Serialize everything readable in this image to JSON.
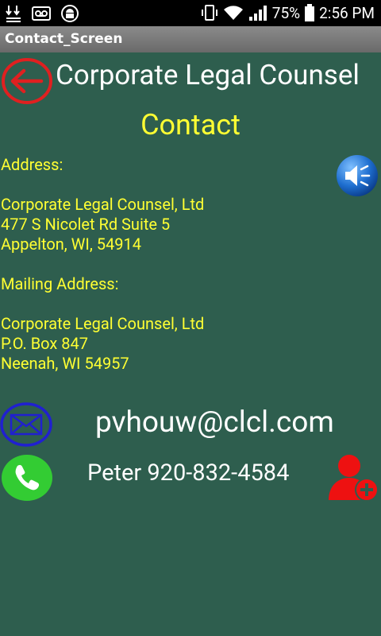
{
  "status_bar": {
    "battery_percent": "75%",
    "time": "2:56 PM",
    "left_icons": [
      "download-arrows-icon",
      "voicemail-icon",
      "android-robot-icon"
    ],
    "right_icons": [
      "vibrate-icon",
      "wifi-icon",
      "cellular-signal-icon",
      "battery-icon"
    ]
  },
  "app_bar": {
    "title": "Contact_Screen"
  },
  "header": {
    "company_name": "Corporate Legal Counsel",
    "back_icon": "back-arrow-icon"
  },
  "section": {
    "heading": "Contact"
  },
  "address": {
    "label": "Address:",
    "line1": "Corporate Legal Counsel, Ltd",
    "line2": "477 S Nicolet Rd Suite 5",
    "line3": "Appelton, WI, 54914"
  },
  "mailing": {
    "label": "Mailing Address:",
    "line1": "Corporate Legal Counsel, Ltd",
    "line2": "P.O. Box 847",
    "line3": "Neenah, WI 54957"
  },
  "email": {
    "value": "pvhouw@clcl.com",
    "icon": "envelope-icon"
  },
  "phone": {
    "value": "Peter 920-832-4584",
    "icon": "phone-icon"
  },
  "add_contact": {
    "icon": "add-contact-icon"
  },
  "colors": {
    "background": "#2e5e4e",
    "accent_yellow": "#ffff33",
    "back_red": "#e02020",
    "envelope_blue": "#2020d0",
    "phone_green": "#33cc33",
    "add_contact_red": "#ee1111"
  }
}
